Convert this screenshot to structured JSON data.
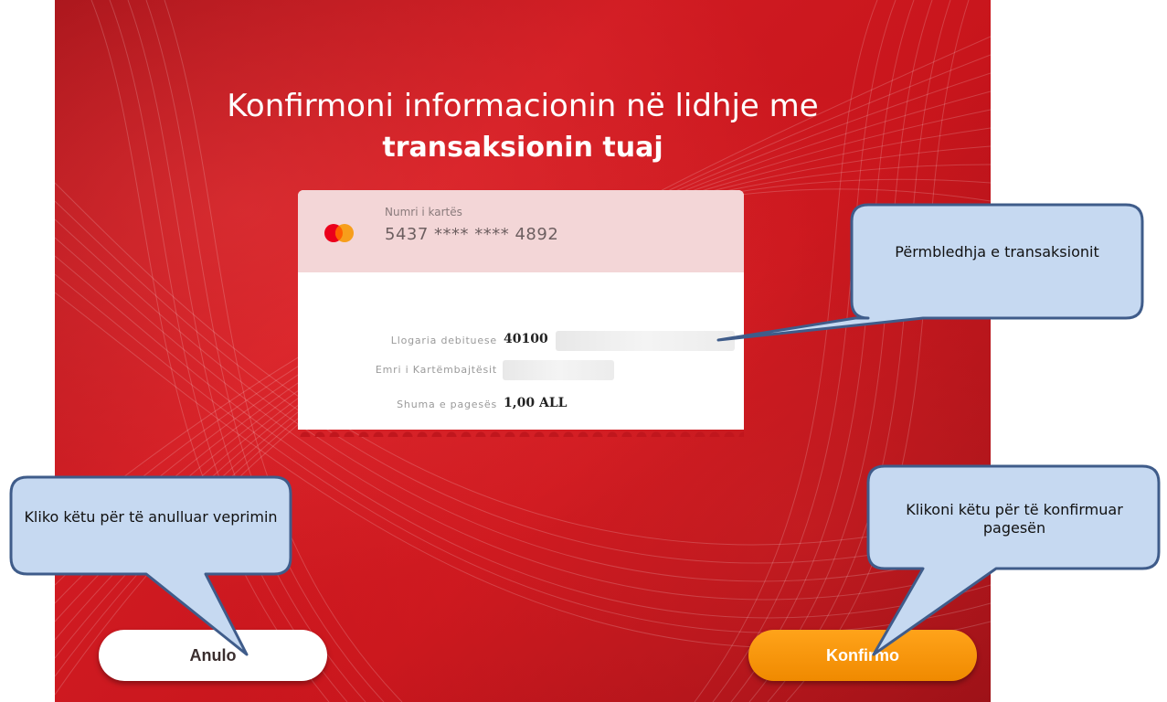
{
  "title": {
    "line1": "Konfirmoni informacionin në lidhje me",
    "line2": "transaksionin tuaj"
  },
  "card": {
    "number_label": "Numri i kartës",
    "number": "5437 **** **** 4892",
    "logo_icon": "mastercard-logo-icon"
  },
  "details": [
    {
      "label": "Llogaria debituese",
      "value": "40100"
    },
    {
      "label": "Emri i Kartëmbajtësit",
      "value": ""
    },
    {
      "label": "Shuma e pagesës",
      "value": "1,00 ALL"
    }
  ],
  "buttons": {
    "cancel_label": "Anulo",
    "confirm_label": "Konfirmo"
  },
  "callouts": {
    "summary": "Përmbledhja e transaksionit",
    "cancel": "Kliko këtu për të anulluar veprimin",
    "confirm": "Klikoni këtu për të konfirmuar pagesën"
  },
  "colors": {
    "background_red": "#c8151c",
    "confirm_orange": "#f99a0c",
    "callout_fill": "#c6d9f1",
    "callout_border": "#3f5c8a"
  }
}
